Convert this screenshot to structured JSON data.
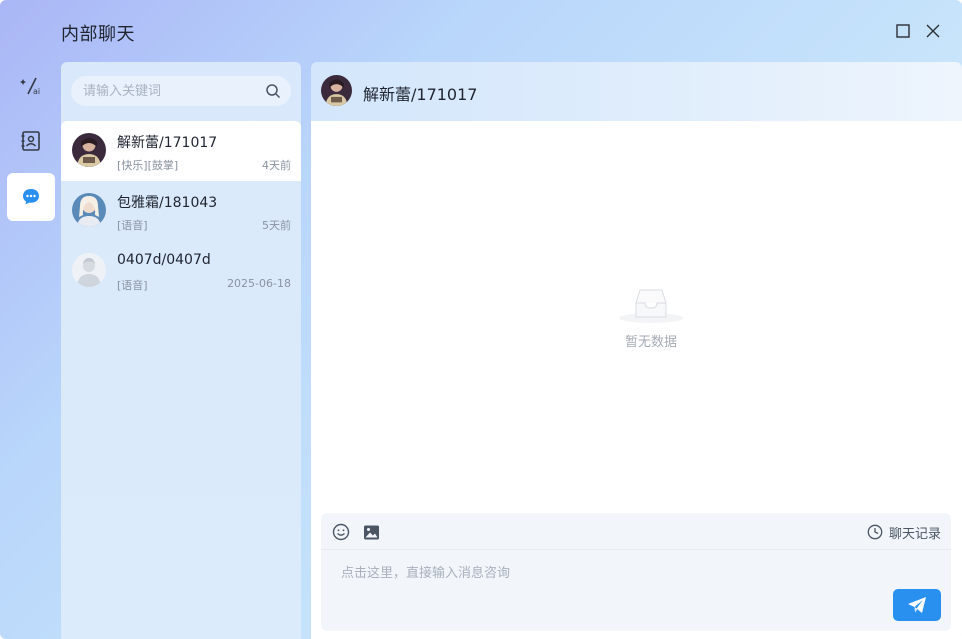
{
  "app": {
    "title": "内部聊天"
  },
  "window_controls": {
    "maximize_icon": "square-icon",
    "close_icon": "x-icon"
  },
  "rail": {
    "items": [
      {
        "id": "ai",
        "icon": "ai-sparkle-icon"
      },
      {
        "id": "contacts",
        "icon": "contact-card-icon"
      },
      {
        "id": "chat",
        "icon": "chat-bubble-icon",
        "active": true
      }
    ]
  },
  "search": {
    "placeholder": "请输入关键词",
    "value": ""
  },
  "conversations": [
    {
      "name": "解新蕾/171017",
      "preview": "[快乐][鼓掌]",
      "time": "4天前",
      "active": true
    },
    {
      "name": "包雅霜/181043",
      "preview": "[语音]",
      "time": "5天前"
    },
    {
      "name": "0407d/0407d",
      "preview": "[语音]",
      "time": "2025-06-18"
    }
  ],
  "chat": {
    "header_name": "解新蕾/171017",
    "empty_text": "暂无数据",
    "history_label": "聊天记录",
    "input_placeholder": "点击这里，直接输入消息咨询",
    "input_value": ""
  },
  "colors": {
    "accent": "#2a90f0",
    "chat_icon": "#2a90f0",
    "title_text": "#1f2430",
    "muted_text": "#8a93a0"
  }
}
